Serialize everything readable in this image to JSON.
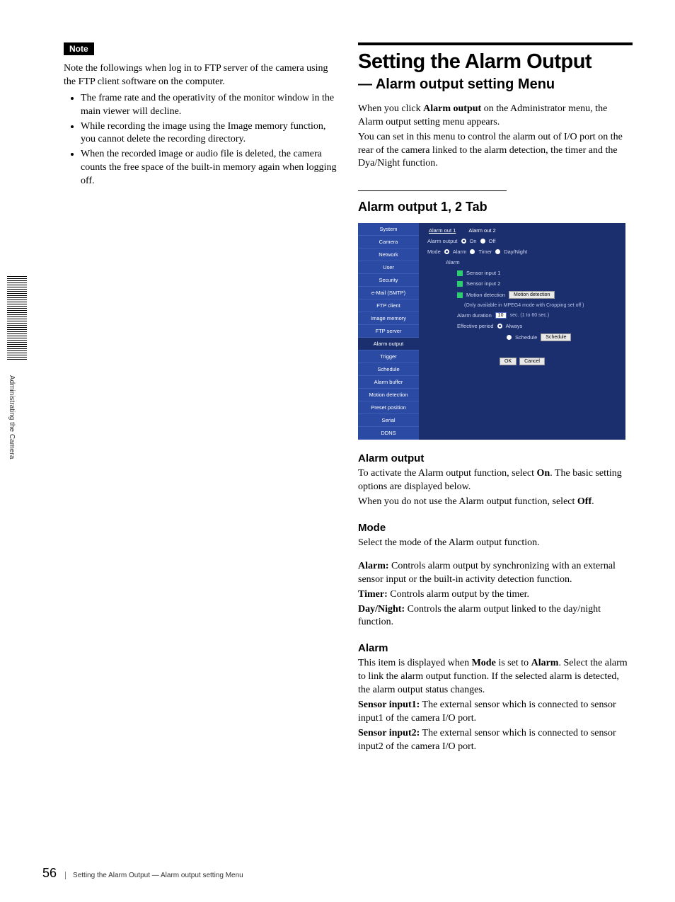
{
  "left": {
    "note_label": "Note",
    "note_intro": "Note the followings when log in to FTP server of the camera using the FTP client software on the computer.",
    "bullets": [
      "The frame rate and the operativity of the monitor window in the main viewer will decline.",
      "While recording the image using the Image memory function, you cannot delete the recording directory.",
      "When the recorded image or audio file is deleted, the camera counts the free space of the built-in memory again when logging off."
    ]
  },
  "side_label": "Administrating the Camera",
  "right": {
    "h1": "Setting the Alarm Output",
    "h2": "— Alarm output setting Menu",
    "intro1_a": "When you click ",
    "intro1_b": "Alarm output",
    "intro1_c": " on the Administrator menu, the Alarm output setting menu appears.",
    "intro2": "You can set in this menu to control the alarm out of I/O port on the rear of the camera linked to the alarm detection, the timer and the Dya/Night function.",
    "tab_heading": "Alarm output 1, 2 Tab",
    "screenshot": {
      "side_items": [
        "System",
        "Camera",
        "Network",
        "User",
        "Security",
        "e-Mail (SMTP)",
        "FTP client",
        "Image memory",
        "FTP server",
        "Alarm output",
        "Trigger",
        "Schedule",
        "Alarm buffer",
        "Motion detection",
        "Preset position",
        "Serial",
        "DDNS"
      ],
      "active_index": 9,
      "tabs": [
        "Alarm out 1",
        "Alarm out 2"
      ],
      "active_tab": 0,
      "alarm_output_label": "Alarm output",
      "on": "On",
      "off": "Off",
      "mode_label": "Mode",
      "mode_opts": [
        "Alarm",
        "Timer",
        "Day/Night"
      ],
      "alarm_group": "Alarm",
      "sensor1": "Sensor input 1",
      "sensor2": "Sensor input 2",
      "motion_label": "Motion detection",
      "motion_btn": "Motion detection",
      "hint": "(Only available in MPEG4 mode with Cropping set off )",
      "alarm_dur_label": "Alarm duration",
      "alarm_dur_val": "10",
      "alarm_dur_suffix": "sec. (1 to 60 sec.)",
      "eff_label": "Effective period",
      "eff_always": "Always",
      "eff_schedule": "Schedule",
      "schedule_btn": "Schedule",
      "ok": "OK",
      "cancel": "Cancel"
    },
    "ao_heading": "Alarm output",
    "ao_p1_a": "To activate the Alarm output function, select ",
    "ao_p1_b": "On",
    "ao_p1_c": ".  The basic setting options are displayed below.",
    "ao_p2_a": "When you do not use the Alarm output function, select ",
    "ao_p2_b": "Off",
    "ao_p2_c": ".",
    "mode_heading": "Mode",
    "mode_p": "Select the mode of the Alarm output function.",
    "mode_defs": [
      {
        "term": "Alarm:",
        "desc": " Controls alarm output by synchronizing with an external sensor input or the built-in activity detection function."
      },
      {
        "term": "Timer:",
        "desc": " Controls alarm output by the timer."
      },
      {
        "term": "Day/Night:",
        "desc": " Controls the alarm output linked to the day/night function."
      }
    ],
    "alarm_heading": "Alarm",
    "alarm_p1_a": "This item is displayed when ",
    "alarm_p1_b": "Mode",
    "alarm_p1_c": " is set to ",
    "alarm_p1_d": "Alarm",
    "alarm_p1_e": ". Select the alarm to link the alarm output function.  If the selected alarm is detected, the alarm output status changes.",
    "alarm_defs": [
      {
        "term": "Sensor input1:",
        "desc": " The external sensor which is connected to sensor input1 of the camera I/O port."
      },
      {
        "term": "Sensor input2:",
        "desc": " The external sensor which is connected to sensor input2 of the camera I/O port."
      }
    ]
  },
  "footer": {
    "page": "56",
    "text": "Setting the Alarm Output — Alarm output setting Menu"
  }
}
